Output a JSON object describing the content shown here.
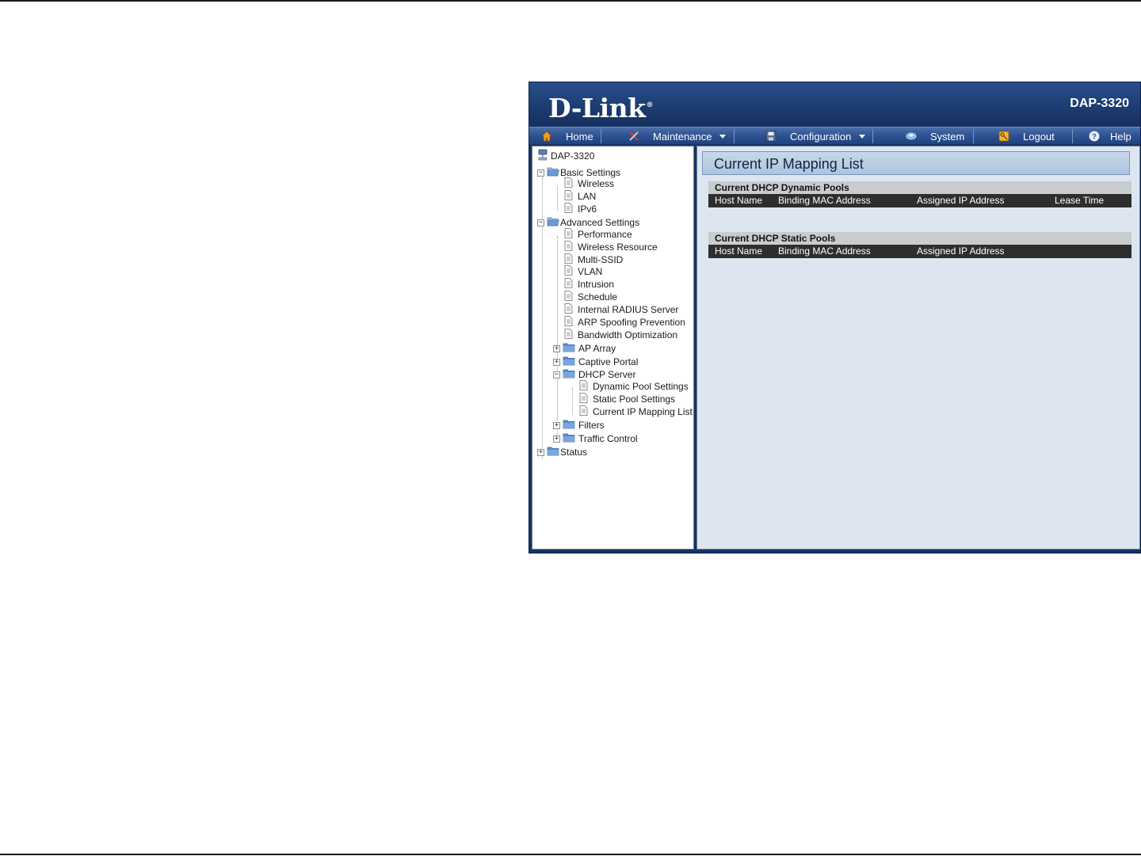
{
  "brand": {
    "logo_text": "D-Link",
    "logo_mark": "®",
    "model": "DAP-3320"
  },
  "nav": {
    "home": "Home",
    "maintenance": "Maintenance",
    "configuration": "Configuration",
    "system": "System",
    "logout": "Logout",
    "help": "Help"
  },
  "tree": {
    "root": "DAP-3320",
    "basic": "Basic Settings",
    "wireless": "Wireless",
    "lan": "LAN",
    "ipv6": "IPv6",
    "advanced": "Advanced Settings",
    "performance": "Performance",
    "wireless_resource": "Wireless Resource",
    "multi_ssid": "Multi-SSID",
    "vlan": "VLAN",
    "intrusion": "Intrusion",
    "schedule": "Schedule",
    "radius": "Internal RADIUS Server",
    "arp": "ARP Spoofing Prevention",
    "bandwidth": "Bandwidth Optimization",
    "ap_array": "AP Array",
    "captive": "Captive Portal",
    "dhcp": "DHCP Server",
    "dynamic_pool": "Dynamic Pool Settings",
    "static_pool": "Static Pool Settings",
    "mapping_list": "Current IP Mapping List",
    "filters": "Filters",
    "traffic": "Traffic Control",
    "status": "Status"
  },
  "content": {
    "title": "Current IP Mapping List",
    "dynamic": {
      "heading": "Current DHCP Dynamic Pools",
      "columns": [
        "Host Name",
        "Binding MAC Address",
        "Assigned IP Address",
        "Lease Time"
      ]
    },
    "static": {
      "heading": "Current DHCP Static Pools",
      "columns": [
        "Host Name",
        "Binding MAC Address",
        "Assigned IP Address"
      ]
    }
  },
  "colors": {
    "banner": "#1b3b6f",
    "navbar": "#2d5191",
    "content_bg": "#dde6f0",
    "column_header": "#2e2e2e"
  }
}
